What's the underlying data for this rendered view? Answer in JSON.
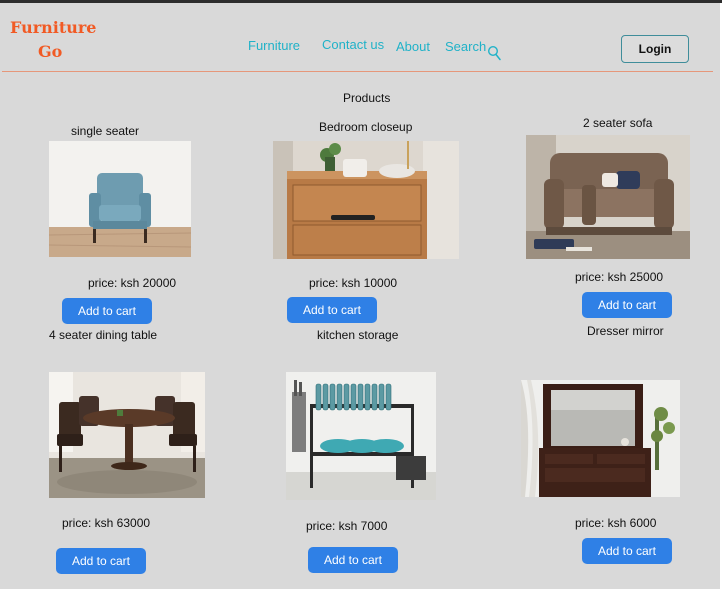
{
  "header": {
    "logo_line1": "Furniture",
    "logo_line2": "Go",
    "nav": [
      "Furniture",
      "Contact us",
      "About",
      "Search"
    ],
    "login_label": "Login"
  },
  "main": {
    "section_title": "Products",
    "products": [
      {
        "title": "single seater",
        "price": "price: ksh 20000",
        "button": "Add to cart"
      },
      {
        "title": "Bedroom closeup",
        "price": "price: ksh 10000",
        "button": "Add to cart"
      },
      {
        "title": "2 seater sofa",
        "price": "price: ksh 25000",
        "button": "Add to cart"
      },
      {
        "title": "4 seater dining table",
        "price": "price: ksh 63000",
        "button": "Add to cart"
      },
      {
        "title": "kitchen storage",
        "price": "price: ksh 7000",
        "button": "Add to cart"
      },
      {
        "title": "Dresser mirror",
        "price": "price: ksh 6000",
        "button": "Add to cart"
      }
    ]
  },
  "colors": {
    "logo": "#f15a24",
    "nav": "#20b2c8",
    "button": "#2f80e6",
    "background": "#d9d9d9"
  }
}
